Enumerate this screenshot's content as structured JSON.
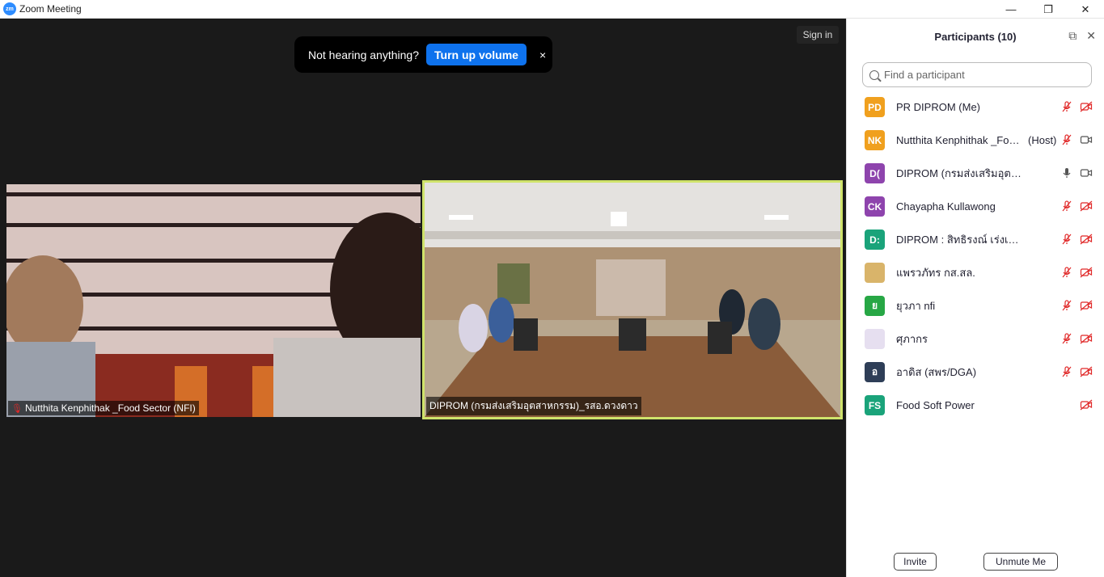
{
  "window": {
    "title": "Zoom Meeting",
    "app_logo": "zm"
  },
  "stage": {
    "sign_in_label": "Sign in",
    "notice": {
      "text": "Not hearing anything?",
      "button_label": "Turn up volume",
      "close_glyph": "×"
    },
    "videos": [
      {
        "name": "Nutthita Kenphithak _Food Sector (NFI)",
        "muted": true
      },
      {
        "name": "DIPROM (กรมส่งเสริมอุตสาหกรรม)_รสอ.ดวงดาว",
        "muted": false
      }
    ]
  },
  "panel": {
    "title": "Participants (10)",
    "search_placeholder": "Find a participant",
    "participants": [
      {
        "initials": "PD",
        "color": "#f0a01e",
        "name": "PR DIPROM (Me)",
        "role": "",
        "mic": "muted",
        "video": "off"
      },
      {
        "initials": "NK",
        "color": "#f0a01e",
        "name": "Nutthita Kenphithak _Food Sector (NFI)",
        "role": "(Host)",
        "mic": "muted",
        "video": "on"
      },
      {
        "initials": "D(",
        "color": "#8e44ad",
        "name": "DIPROM (กรมส่งเสริมอุตสาหกรรม)_รสอ.ดวงดาว",
        "role": "",
        "mic": "on",
        "video": "on"
      },
      {
        "initials": "CK",
        "color": "#8e44ad",
        "name": "Chayapha Kullawong",
        "role": "",
        "mic": "muted",
        "video": "off"
      },
      {
        "initials": "D:",
        "color": "#1aa37a",
        "name": "DIPROM : สิทธิรงณ์ เร่งเพียร",
        "role": "",
        "mic": "muted",
        "video": "off"
      },
      {
        "initials": "",
        "color": "#d9b46a",
        "name": "แพรวภัทร กส.สล.",
        "role": "",
        "mic": "muted",
        "video": "off"
      },
      {
        "initials": "ย",
        "color": "#27a745",
        "name": "ยุวภา nfi",
        "role": "",
        "mic": "muted",
        "video": "off"
      },
      {
        "initials": "",
        "color": "#e6dff0",
        "name": "ศุภากร",
        "role": "",
        "mic": "muted",
        "video": "off"
      },
      {
        "initials": "อ",
        "color": "#2e3e57",
        "name": "อาดิส (สพร/DGA)",
        "role": "",
        "mic": "muted",
        "video": "off"
      },
      {
        "initials": "FS",
        "color": "#1aa37a",
        "name": "Food Soft Power",
        "role": "",
        "mic": "none",
        "video": "off"
      }
    ],
    "footer": {
      "invite_label": "Invite",
      "unmute_label": "Unmute Me"
    }
  }
}
